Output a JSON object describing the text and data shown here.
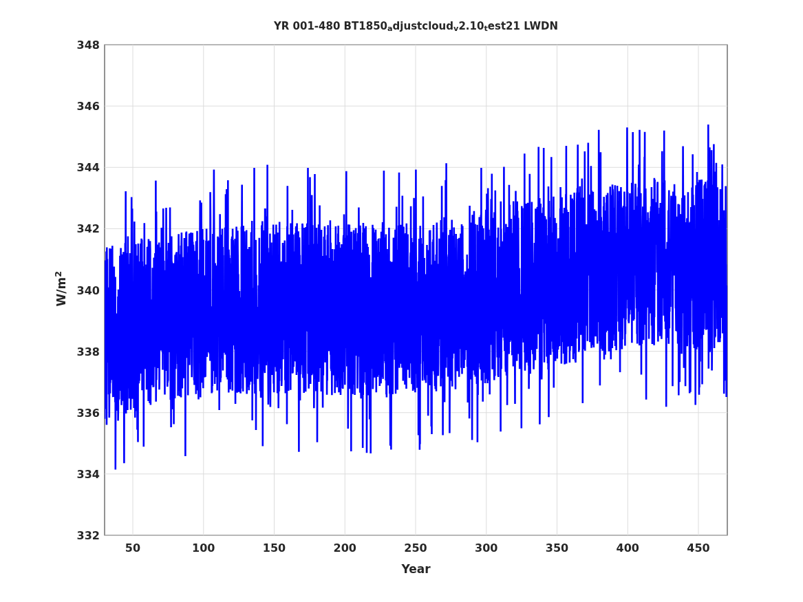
{
  "figure": {
    "title": "YR 001-480 BT1850$_{a}$djustcloud$_{v}$2.10$_{t}$est21 LWDN",
    "xlabel": "Year",
    "ylabel": "W/m$^{2}$",
    "xticks": [
      "50",
      "100",
      "150",
      "200",
      "250",
      "300",
      "350",
      "400",
      "450"
    ],
    "yticks": [
      "348",
      "346",
      "344",
      "342",
      "340",
      "338",
      "336",
      "334",
      "332"
    ]
  }
}
